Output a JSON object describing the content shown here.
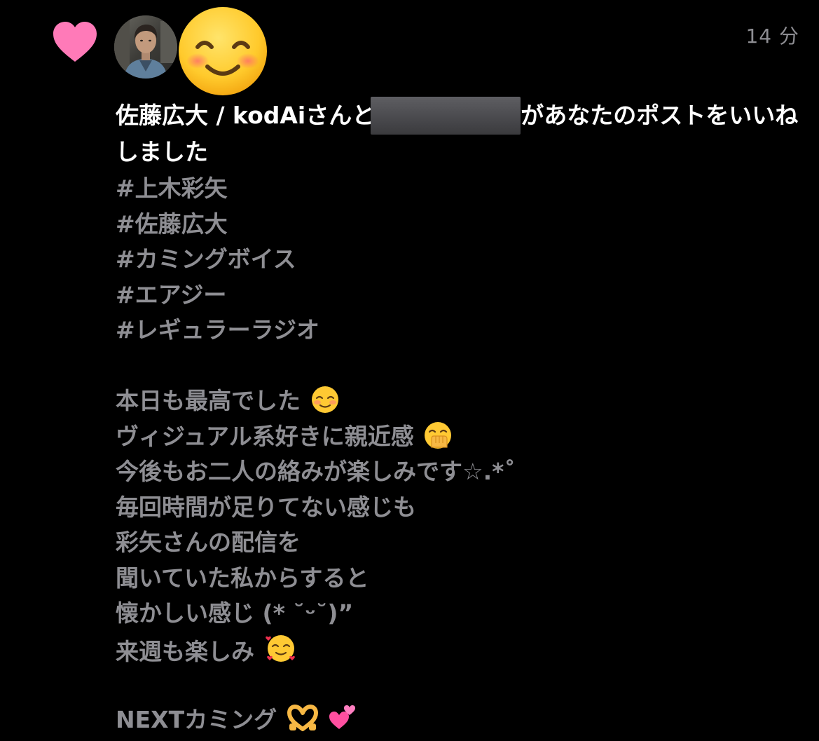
{
  "notification": {
    "timestamp": "14 分",
    "liker_name": "佐藤広大 / kodAi",
    "text_after_name": "さんと",
    "text_after_redacted": "があなたのポストをいいねしました"
  },
  "post": {
    "hashtags": [
      "#上木彩矢",
      "#佐藤広大",
      "#カミングボイス",
      "#エアジー",
      "#レギュラーラジオ"
    ],
    "lines": [
      "本日も最高でした",
      "ヴィジュアル系好きに親近感",
      "今後もお二人の絡みが楽しみです☆.*˚",
      "毎回時間が足りてない感じも",
      "彩矢さんの配信を",
      "聞いていた私からすると",
      "懐かしい感じ (* ˘ᵕ˘)”",
      "来週も楽しみ"
    ],
    "closing": "NEXTカミング"
  },
  "icons": {
    "heart": "heart-icon",
    "smiling_face": "smiling-face-icon",
    "blush": "relieved-face-icon",
    "hand_over_mouth": "hand-over-mouth-icon",
    "hearts_face": "smiling-face-with-hearts-icon",
    "heart_hands": "heart-hands-icon",
    "two_hearts": "two-hearts-icon"
  },
  "colors": {
    "background": "#000000",
    "heart": "#ff7ab8",
    "primary_text": "#ffffff",
    "secondary_text": "#8e8e93"
  }
}
